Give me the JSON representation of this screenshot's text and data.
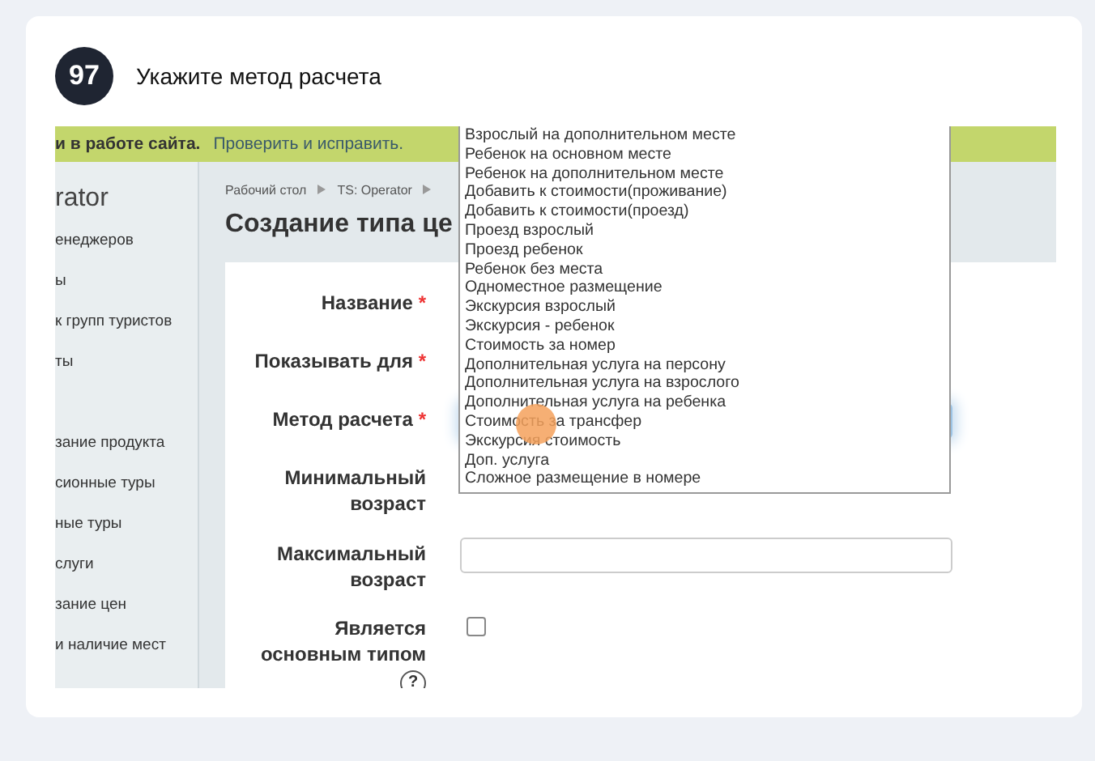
{
  "step": {
    "number": "97",
    "instruction": "Укажите метод расчета"
  },
  "screen": {
    "notice": {
      "text": "и в работе сайта.",
      "link": "Проверить и исправить."
    },
    "sidebar": {
      "title": "rator",
      "groups": [
        [
          "енеджеров",
          "ы",
          "к групп туристов",
          "ты"
        ],
        [
          "зание продукта",
          "сионные туры",
          "ные туры",
          "слуги",
          "зание цен",
          "и наличие мест"
        ]
      ]
    },
    "breadcrumb": [
      "Рабочий стол",
      "TS: Operator"
    ],
    "page_title": "Создание типа це",
    "form": {
      "fields": [
        {
          "label": "Название",
          "required_mark": "*",
          "kind": "covered"
        },
        {
          "label": "Показывать для",
          "required_mark": "*",
          "kind": "covered"
        },
        {
          "label": "Метод расчета",
          "required_mark": "*",
          "kind": "select"
        },
        {
          "label": "Минимальный возраст",
          "kind": "covered"
        },
        {
          "label": "Максимальный возраст",
          "kind": "text"
        },
        {
          "label": "Является основным типом",
          "kind": "checkbox",
          "checked": false,
          "help": "?"
        }
      ]
    },
    "dropdown": {
      "options": [
        "Взрослый на дополнительном месте",
        "Ребенок на основном месте",
        "Ребенок на дополнительном месте",
        "Добавить к стоимости(проживание)",
        "Добавить к стоимости(проезд)",
        "Проезд взрослый",
        "Проезд ребенок",
        "Ребенок без места",
        "Одноместное размещение",
        "Экскурсия взрослый",
        "Экскурсия - ребенок",
        "Стоимость за номер",
        "Дополнительная услуга на персону",
        "Дополнительная услуга на взрослого",
        "Дополнительная услуга на ребенка",
        "Стоимость за трансфер",
        "Экскурсия стоимость",
        "Доп. услуга",
        "Сложное размещение в номере"
      ]
    }
  }
}
